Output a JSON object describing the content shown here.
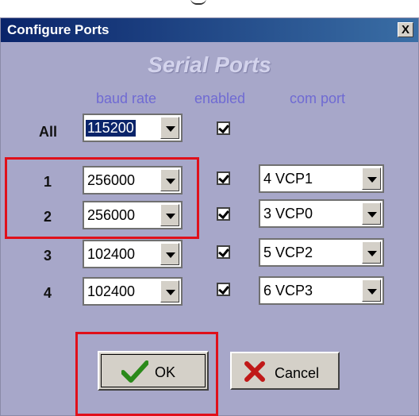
{
  "window": {
    "title": "Configure Ports",
    "close_label": "X"
  },
  "section_title": "Serial Ports",
  "columns": {
    "baud_rate": "baud rate",
    "enabled": "enabled",
    "com_port": "com port"
  },
  "rows": [
    {
      "label": "All",
      "baud": "115200",
      "enabled": true
    },
    {
      "label": "1",
      "baud": "256000",
      "enabled": true,
      "com": "4 VCP1"
    },
    {
      "label": "2",
      "baud": "256000",
      "enabled": true,
      "com": "3 VCP0"
    },
    {
      "label": "3",
      "baud": "102400",
      "enabled": true,
      "com": "5 VCP2"
    },
    {
      "label": "4",
      "baud": "102400",
      "enabled": true,
      "com": "6 VCP3"
    }
  ],
  "buttons": {
    "ok": "OK",
    "cancel": "Cancel"
  },
  "icons": {
    "ok": "checkmark-icon",
    "cancel": "x-mark-icon"
  },
  "colors": {
    "highlight": "#e0101a",
    "ok_icon": "#2a8a1a",
    "cancel_icon": "#c01818"
  }
}
